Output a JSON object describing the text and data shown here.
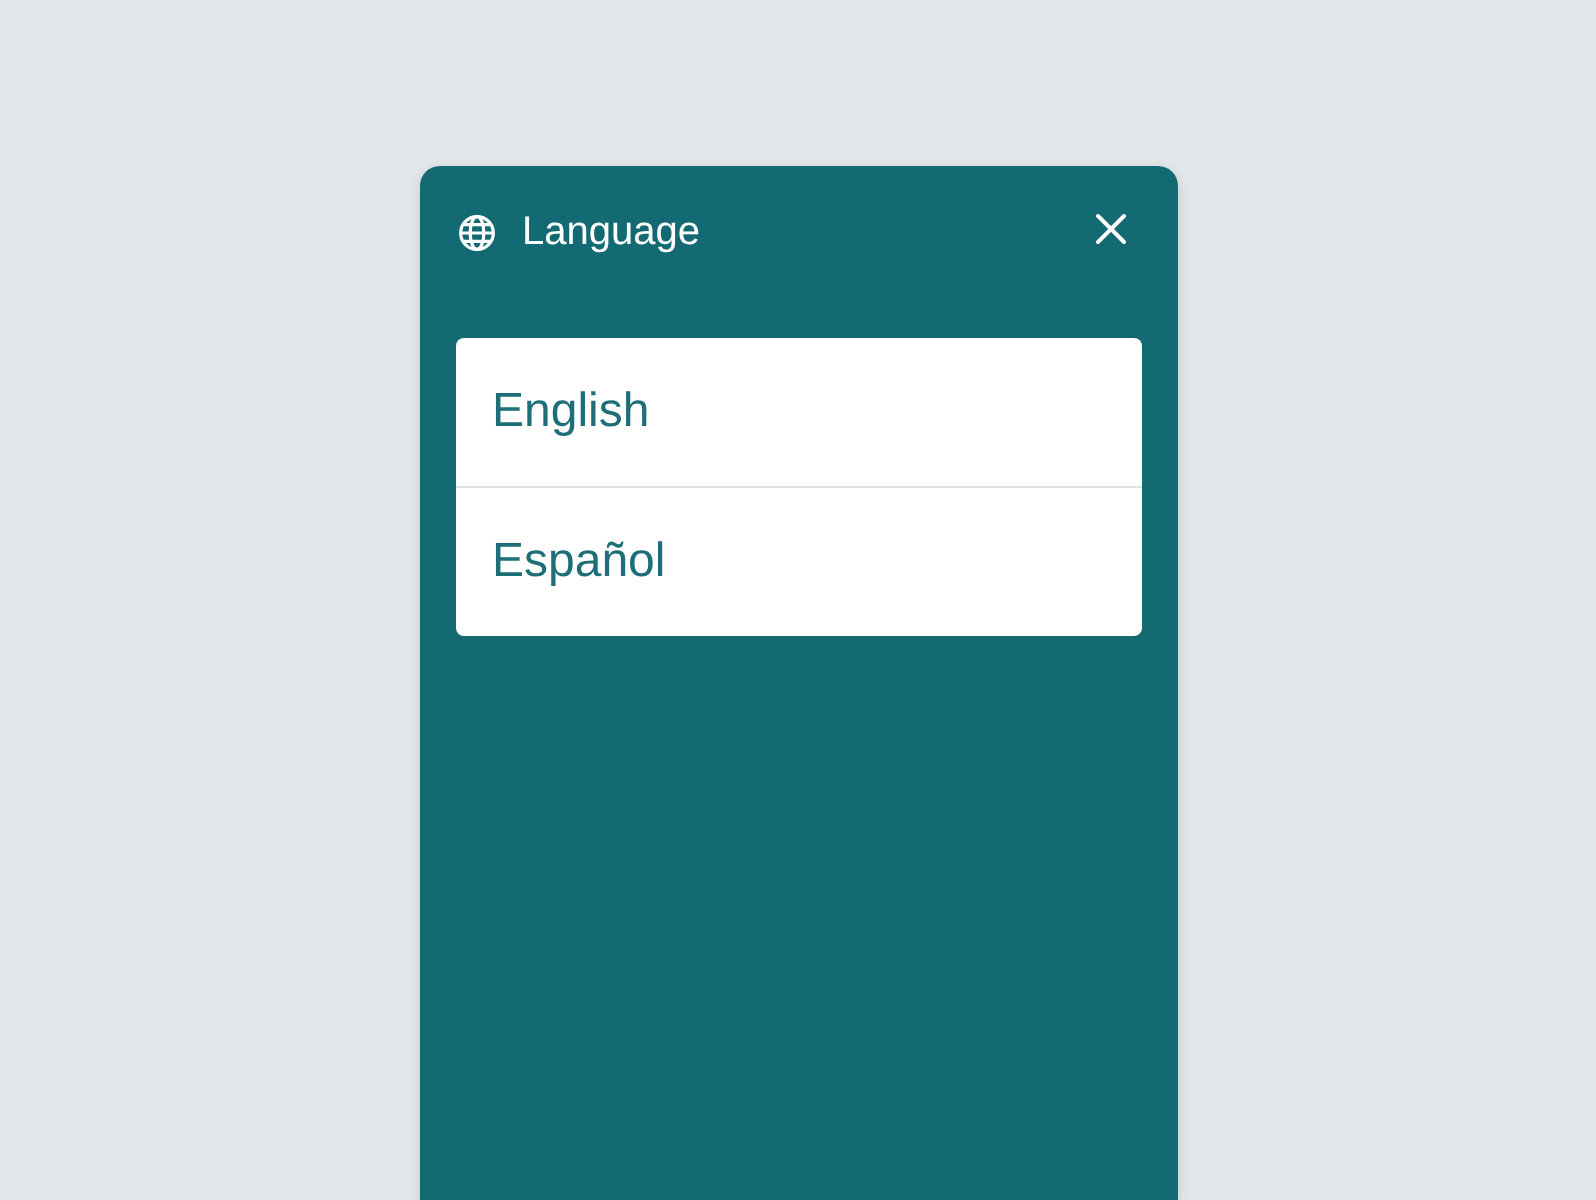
{
  "dialog": {
    "title": "Language"
  },
  "languages": [
    {
      "label": "English"
    },
    {
      "label": "Español"
    }
  ]
}
